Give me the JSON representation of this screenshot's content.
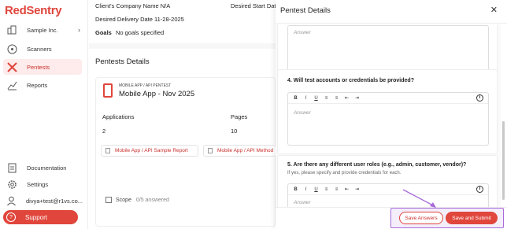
{
  "app": {
    "logo": "RedSentry",
    "brand_color": "#e0463c"
  },
  "sidebar": {
    "org": {
      "label": "Sample Inc.",
      "icon": "building-icon"
    },
    "items": [
      {
        "label": "Scanners",
        "icon": "radar-icon",
        "active": false
      },
      {
        "label": "Pentests",
        "icon": "crossed-swords-icon",
        "active": true
      },
      {
        "label": "Reports",
        "icon": "chart-icon",
        "active": false
      }
    ],
    "bottom": [
      {
        "label": "Documentation",
        "icon": "document-icon"
      },
      {
        "label": "Settings",
        "icon": "gear-icon"
      },
      {
        "label": "divya+test@r1vs.co...",
        "icon": "user-icon"
      }
    ],
    "support": {
      "label": "Support",
      "icon": "help-icon"
    }
  },
  "info": {
    "company": "Client's Company Name  N/A",
    "start": "Desired Start Dat",
    "delivery": "Desired Delivery Date  11-28-2025",
    "goals_label": "Goals",
    "goals_value": "No goals specified"
  },
  "pentests": {
    "title": "Pentests Details",
    "item": {
      "kind": "MOBILE APP / API PENTEST",
      "name": "Mobile App - Nov 2025",
      "applications_label": "Applications",
      "applications_value": "2",
      "pages_label": "Pages",
      "pages_value": "10",
      "chips": [
        "Mobile App / API Sample Report",
        "Mobile App / API Method"
      ],
      "scope_label": "Scope",
      "scope_count": "0/5 answered"
    }
  },
  "modal": {
    "title": "Pentest Details",
    "answer_placeholder": "Answer",
    "toolbar": [
      "B",
      "I",
      "U",
      "≡",
      "≡",
      "⇤",
      "⇥"
    ],
    "questions": [
      {
        "text": "4. Will test accounts or credentials be provided?",
        "sub": ""
      },
      {
        "text": "5. Are there any different user roles (e.g., admin, customer, vendor)?",
        "sub": "If yes, please specify and provide credentials for each."
      }
    ],
    "save_label": "Save Answers",
    "submit_label": "Save and Submit"
  }
}
